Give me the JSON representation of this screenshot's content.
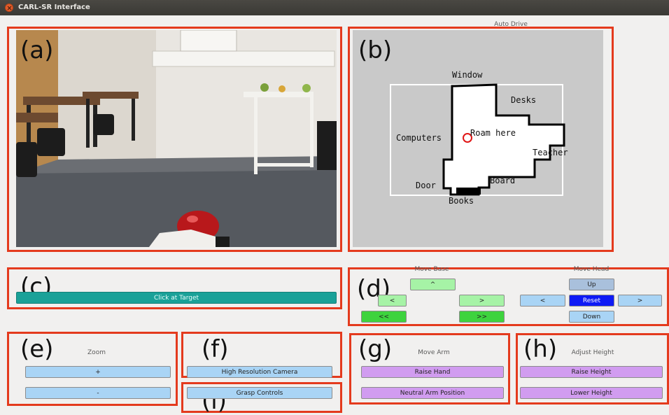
{
  "window": {
    "title": "CARL-SR Interface"
  },
  "panels": {
    "a": "(a)",
    "b": "(b)",
    "c": "(c)",
    "d": "(d)",
    "e": "(e)",
    "f": "(f)",
    "g": "(g)",
    "h": "(h)",
    "i": "(i)"
  },
  "auto_drive": {
    "title": "Auto Drive",
    "map_labels": {
      "window": "Window",
      "desks": "Desks",
      "computers": "Computers",
      "roam": "Roam here",
      "teacher": "Teacher",
      "door": "Door",
      "board": "Board",
      "books": "Books"
    }
  },
  "target": {
    "click_label": "Click at Target"
  },
  "move_base": {
    "title": "Move Base",
    "forward": "^",
    "left": "<",
    "right": ">",
    "rotate_left": "<<",
    "rotate_right": ">>"
  },
  "move_head": {
    "title": "Move Head",
    "up": "Up",
    "left": "<",
    "reset": "Reset",
    "right": ">",
    "down": "Down"
  },
  "zoom": {
    "title": "Zoom",
    "plus": "+",
    "minus": "-"
  },
  "camera": {
    "high_res": "High Resolution Camera"
  },
  "grasp": {
    "label": "Grasp Controls"
  },
  "move_arm": {
    "title": "Move Arm",
    "raise_hand": "Raise Hand",
    "neutral": "Neutral Arm Position"
  },
  "adjust_height": {
    "title": "Adjust Height",
    "raise": "Raise Height",
    "lower": "Lower Height"
  },
  "colors": {
    "highlight": "#e43a1d",
    "blue_button": "#a9d4f5",
    "green_button": "#a6f3a6",
    "green_dark_button": "#3ed33e",
    "reset_button": "#0e1af5",
    "purple_button": "#d19cf0",
    "teal_button": "#1aa198"
  }
}
